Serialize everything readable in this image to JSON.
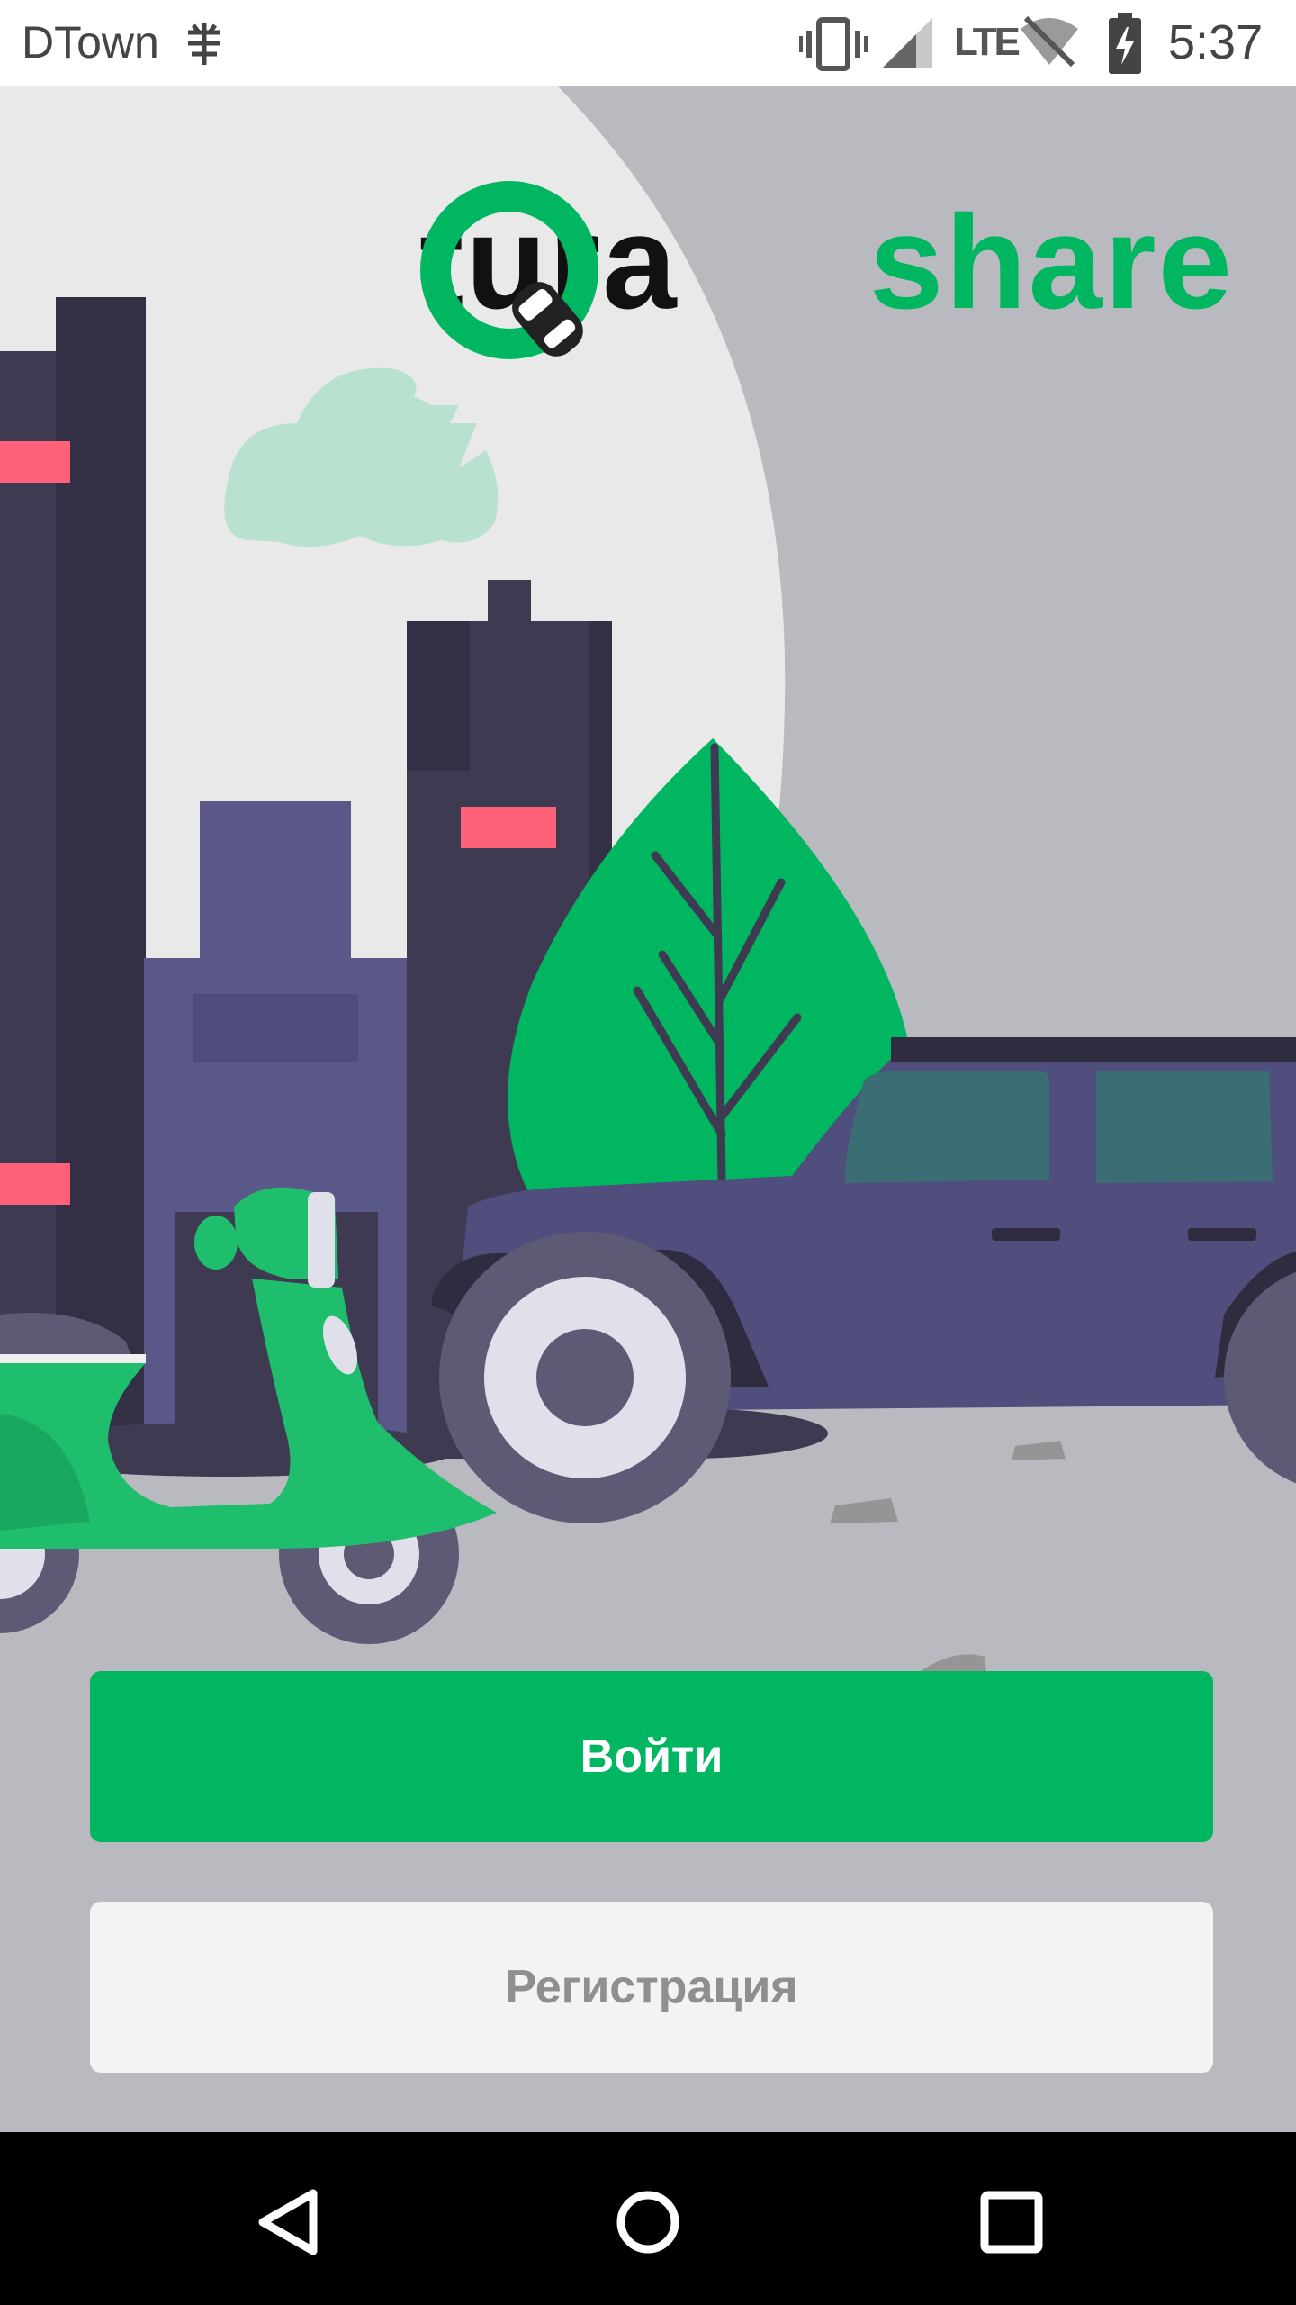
{
  "status_bar": {
    "carrier": "DTown",
    "network": "LTE",
    "time": "5:37"
  },
  "logo": {
    "left_text": "tura",
    "right_text": "share"
  },
  "buttons": {
    "login_label": "Войти",
    "register_label": "Регистрация"
  },
  "colors": {
    "brand_green": "#00b661",
    "background": "#b9b9c0",
    "secondary_button": "#f3f3f3"
  },
  "icons": [
    "cell-tower-icon",
    "vibrate-icon",
    "signal-icon",
    "wifi-off-icon",
    "battery-charging-icon",
    "car-icon",
    "back-icon",
    "home-icon",
    "recents-icon"
  ]
}
